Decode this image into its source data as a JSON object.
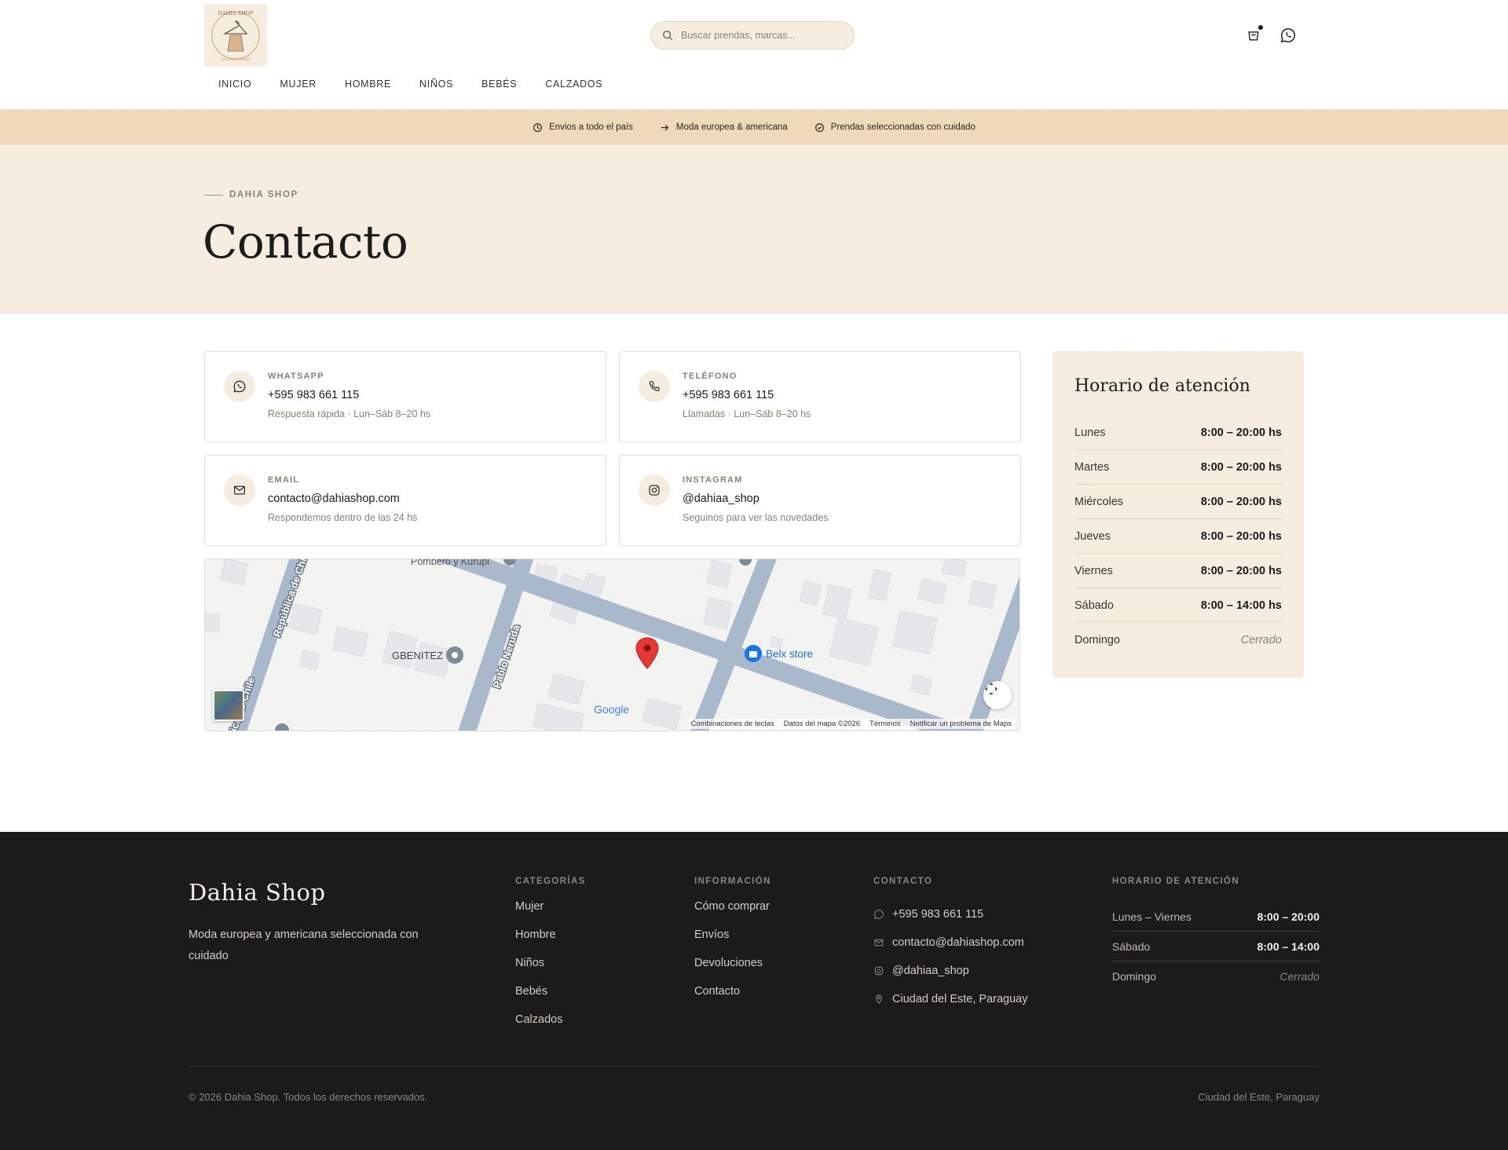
{
  "header": {
    "logo_text": "DAHIA SHOP",
    "logo_subtext": "SEGUNDA MANO",
    "search_placeholder": "Buscar prendas, marcas...",
    "nav": [
      "INICIO",
      "MUJER",
      "HOMBRE",
      "NIÑOS",
      "BEBÉS",
      "CALZADOS"
    ]
  },
  "announce": [
    {
      "icon": "clock-icon",
      "text": "Envios a todo el país"
    },
    {
      "icon": "arrow-right-icon",
      "text": "Moda europea & americana"
    },
    {
      "icon": "check-circle-icon",
      "text": "Prendas seleccionadas con cuidado"
    }
  ],
  "hero": {
    "eyebrow": "DAHIA SHOP",
    "title": "Contacto"
  },
  "cards": [
    {
      "icon": "whatsapp-icon",
      "label": "WHATSAPP",
      "value": "+595 983 661 115",
      "sub": "Respuesta rápida · Lun–Sáb 8–20 hs"
    },
    {
      "icon": "phone-icon",
      "label": "TELÉFONO",
      "value": "+595 983 661 115",
      "sub": "Llamadas · Lun–Sáb 8–20 hs"
    },
    {
      "icon": "mail-icon",
      "label": "EMAIL",
      "value": "contacto@dahiashop.com",
      "sub": "Respondemos dentro de las 24 hs"
    },
    {
      "icon": "instagram-icon",
      "label": "INSTAGRAM",
      "value": "@dahiaa_shop",
      "sub": "Seguinos para ver las novedades"
    }
  ],
  "map": {
    "streets": [
      "República de Chile",
      "Pablo Neruda"
    ],
    "places": [
      "Pombero y Kurupi",
      "GBENITEZ",
      "Belx store"
    ],
    "google": "Google",
    "attribution": [
      "Combinaciones de teclas",
      "Datos del mapa ©2026",
      "Términos",
      "Notificar un problema de Maps"
    ]
  },
  "hours": {
    "title": "Horario de atención",
    "rows": [
      {
        "day": "Lunes",
        "time": "8:00 – 20:00 hs"
      },
      {
        "day": "Martes",
        "time": "8:00 – 20:00 hs"
      },
      {
        "day": "Miércoles",
        "time": "8:00 – 20:00 hs"
      },
      {
        "day": "Jueves",
        "time": "8:00 – 20:00 hs"
      },
      {
        "day": "Viernes",
        "time": "8:00 – 20:00 hs"
      },
      {
        "day": "Sábado",
        "time": "8:00 – 14:00 hs"
      },
      {
        "day": "Domingo",
        "time": "Cerrado"
      }
    ]
  },
  "footer": {
    "brand": "Dahia Shop",
    "tagline": "Moda europea y americana seleccionada con cuidado",
    "categories_title": "CATEGORÍAS",
    "categories": [
      "Mujer",
      "Hombre",
      "Niños",
      "Bebés",
      "Calzados"
    ],
    "info_title": "INFORMACIÓN",
    "info": [
      "Cómo comprar",
      "Envíos",
      "Devoluciones",
      "Contacto"
    ],
    "contact_title": "CONTACTO",
    "contact": [
      {
        "icon": "whatsapp-icon",
        "text": "+595 983 661 115"
      },
      {
        "icon": "mail-icon",
        "text": "contacto@dahiashop.com"
      },
      {
        "icon": "instagram-icon",
        "text": "@dahiaa_shop"
      },
      {
        "icon": "location-pin-icon",
        "text": "Ciudad del Este, Paraguay"
      }
    ],
    "hours_title": "HORARIO DE ATENCIÓN",
    "hours": [
      {
        "day": "Lunes – Viernes",
        "time": "8:00 – 20:00"
      },
      {
        "day": "Sábado",
        "time": "8:00 – 14:00"
      },
      {
        "day": "Domingo",
        "time": "Cerrado"
      }
    ],
    "copyright": "© 2026 Dahia Shop. Todos los derechos reservados.",
    "location": "Ciudad del Este, Paraguay"
  },
  "colors": {
    "cream": "#f6ece0",
    "sand": "#efd9bb",
    "footer_bg": "#1c1b1b",
    "map_road": "#a9b8cb",
    "marker": "#e53935"
  }
}
